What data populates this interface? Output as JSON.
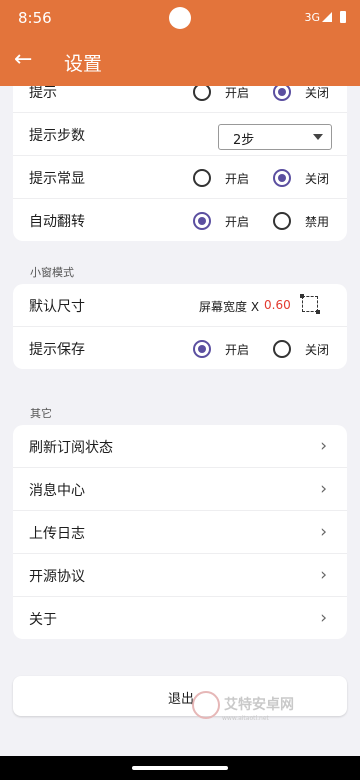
{
  "status_bar": {
    "time": "8:56",
    "network": "3G"
  },
  "app_bar": {
    "title": "设置"
  },
  "top_card": {
    "partial_row": {
      "label": "提示",
      "opt_on": "开启",
      "opt_off": "关闭"
    },
    "hint_steps": {
      "label": "提示步数",
      "selected": "2步"
    },
    "hint_always": {
      "label": "提示常显",
      "opt_on": "开启",
      "opt_off": "关闭",
      "value": "关闭"
    },
    "auto_flip": {
      "label": "自动翻转",
      "opt_on": "开启",
      "opt_off": "禁用",
      "value": "开启"
    }
  },
  "small_window": {
    "section_title": "小窗模式",
    "default_size": {
      "label": "默认尺寸",
      "text": "屏幕宽度 X",
      "value": "0.60"
    },
    "hint_save": {
      "label": "提示保存",
      "opt_on": "开启",
      "opt_off": "关闭",
      "value": "开启"
    }
  },
  "other": {
    "section_title": "其它",
    "items": [
      {
        "label": "刷新订阅状态"
      },
      {
        "label": "消息中心"
      },
      {
        "label": "上传日志"
      },
      {
        "label": "开源协议"
      },
      {
        "label": "关于"
      }
    ]
  },
  "logout": {
    "label": "退出"
  },
  "watermark": {
    "text": "艾特安卓网",
    "sub": "www.aitaotl.net"
  },
  "colors": {
    "accent": "#e3743b",
    "radio": "#5b4fa0",
    "value_red": "#e23a2e"
  }
}
